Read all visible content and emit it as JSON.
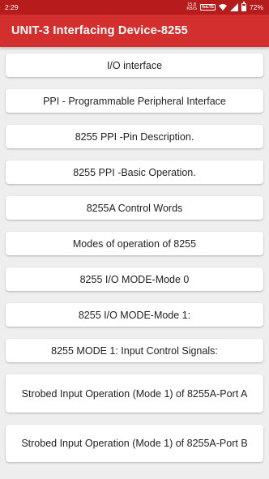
{
  "status_bar": {
    "time": "2:29",
    "net_speed_value": "15.8",
    "net_speed_unit": "KB/S",
    "volte_badge": "VoLTE",
    "battery_percent": "72%",
    "battery_level": 0.72,
    "icons": [
      "wifi-icon",
      "signal-icon",
      "battery-icon"
    ]
  },
  "app_bar": {
    "title": "UNIT-3 Interfacing Device-8255",
    "color": "#d32f2f"
  },
  "topics": [
    "I/O interface",
    "PPI - Programmable Peripheral Interface",
    "8255 PPI -Pin Description.",
    "8255 PPI -Basic Operation.",
    "8255A Control Words",
    "Modes of operation of 8255",
    "8255 I/O MODE-Mode 0",
    "8255 I/O MODE-Mode 1:",
    "8255 MODE 1: Input  Control Signals:",
    "Strobed Input Operation (Mode 1) of 8255A-Port A",
    "Strobed Input Operation (Mode 1) of 8255A-Port B"
  ]
}
